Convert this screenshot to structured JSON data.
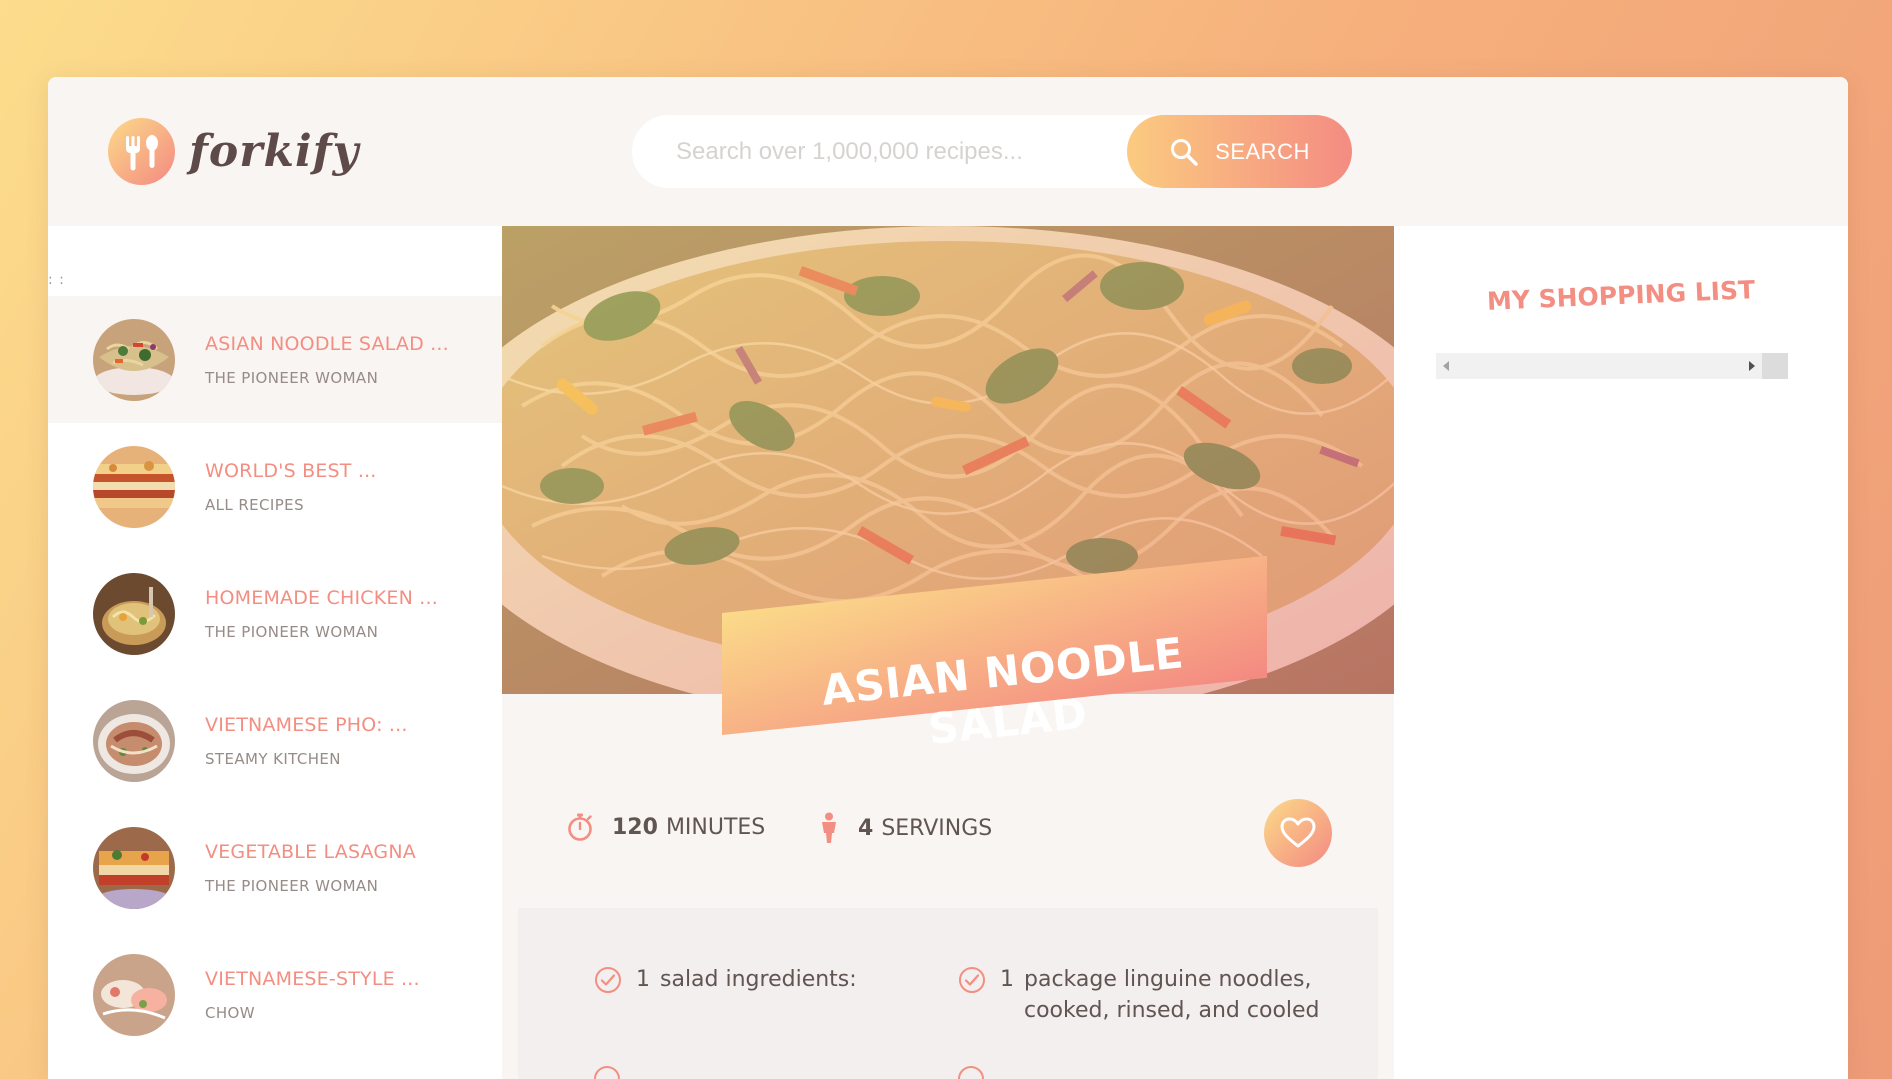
{
  "logo": {
    "text": "forkify"
  },
  "search": {
    "placeholder": "Search over 1,000,000 recipes...",
    "button_label": "SEARCH"
  },
  "results": {
    "marker": ": :",
    "items": [
      {
        "title": "Asian Noodle Salad ...",
        "author": "The Pioneer Woman",
        "active": true
      },
      {
        "title": "World's Best ...",
        "author": "All Recipes",
        "active": false
      },
      {
        "title": "Homemade Chicken ...",
        "author": "The Pioneer Woman",
        "active": false
      },
      {
        "title": "Vietnamese Pho: ...",
        "author": "Steamy Kitchen",
        "active": false
      },
      {
        "title": "Vegetable Lasagna",
        "author": "The Pioneer Woman",
        "active": false
      },
      {
        "title": "Vietnamese-Style ...",
        "author": "Chow",
        "active": false
      }
    ]
  },
  "recipe": {
    "title": "Asian Noodle Salad",
    "minutes": "120",
    "minutes_label": "Minutes",
    "servings": "4",
    "servings_label": "Servings",
    "ingredients": [
      {
        "qty": "1",
        "text": "salad ingredients:"
      },
      {
        "qty": "1",
        "text": "package linguine noodles,",
        "text2": "cooked, rinsed, and cooled"
      }
    ]
  },
  "shopping": {
    "title": "My Shopping List"
  },
  "colors": {
    "accent": "#f38e82",
    "gradient_start": "#fbdb89",
    "gradient_end": "#f48982",
    "text": "#615551"
  }
}
